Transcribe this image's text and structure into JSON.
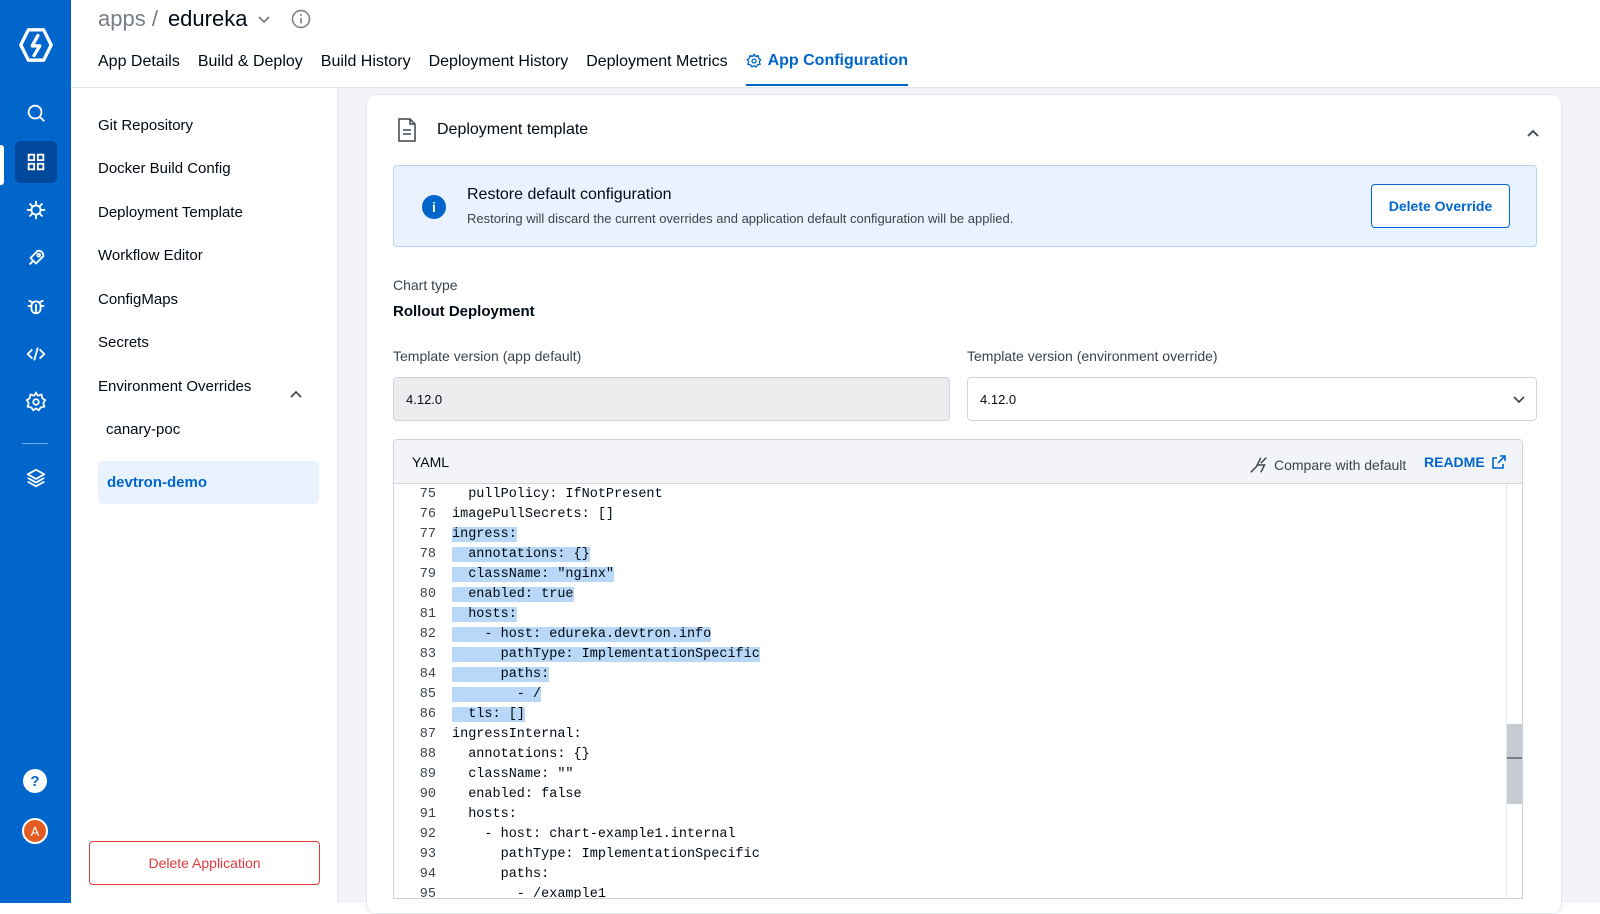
{
  "header": {
    "breadcrumb_parent": "apps /",
    "app_name": "edureka",
    "tabs": [
      "App Details",
      "Build & Deploy",
      "Build History",
      "Deployment History",
      "Deployment Metrics",
      "App Configuration"
    ]
  },
  "sidebar": {
    "items": [
      "Git Repository",
      "Docker Build Config",
      "Deployment Template",
      "Workflow Editor",
      "ConfigMaps",
      "Secrets",
      "Environment Overrides"
    ],
    "env_overrides": [
      "canary-poc",
      "devtron-demo"
    ],
    "delete_label": "Delete Application"
  },
  "rail": {
    "icons": [
      "devtron-logo-icon",
      "search-icon",
      "apps-grid-icon",
      "helm-wheel-icon",
      "rocket-icon",
      "bug-icon",
      "code-icon",
      "gear-icon",
      "stack-icon",
      "help-icon",
      "avatar"
    ],
    "avatar_initial": "A",
    "help_glyph": "?"
  },
  "main": {
    "card_title": "Deployment template",
    "restore": {
      "title": "Restore default configuration",
      "desc": "Restoring will discard the current overrides and application default configuration will be applied.",
      "button": "Delete Override",
      "info_glyph": "i"
    },
    "chart_type_label": "Chart type",
    "chart_type_value": "Rollout Deployment",
    "tv_default_label": "Template version (app default)",
    "tv_default_value": "4.12.0",
    "tv_override_label": "Template version (environment override)",
    "tv_override_value": "4.12.0",
    "yaml": {
      "title": "YAML",
      "compare": "Compare with default",
      "readme": "README",
      "lines": [
        {
          "n": "75",
          "t": "  pullPolicy: IfNotPresent",
          "hl": false
        },
        {
          "n": "76",
          "t": "imagePullSecrets: []",
          "hl": false
        },
        {
          "n": "77",
          "t": "ingress:",
          "hl": true
        },
        {
          "n": "78",
          "t": "  annotations: {}",
          "hl": true
        },
        {
          "n": "79",
          "t": "  className: \"nginx\"",
          "hl": true
        },
        {
          "n": "80",
          "t": "  enabled: true",
          "hl": true
        },
        {
          "n": "81",
          "t": "  hosts:",
          "hl": true
        },
        {
          "n": "82",
          "t": "    - host: edureka.devtron.info",
          "hl": true
        },
        {
          "n": "83",
          "t": "      pathType: ImplementationSpecific",
          "hl": true
        },
        {
          "n": "84",
          "t": "      paths:",
          "hl": true
        },
        {
          "n": "85",
          "t": "        - /",
          "hl": true
        },
        {
          "n": "86",
          "t": "  tls: []",
          "hl": true
        },
        {
          "n": "87",
          "t": "ingressInternal:",
          "hl": false
        },
        {
          "n": "88",
          "t": "  annotations: {}",
          "hl": false
        },
        {
          "n": "89",
          "t": "  className: \"\"",
          "hl": false
        },
        {
          "n": "90",
          "t": "  enabled: false",
          "hl": false
        },
        {
          "n": "91",
          "t": "  hosts:",
          "hl": false
        },
        {
          "n": "92",
          "t": "    - host: chart-example1.internal",
          "hl": false
        },
        {
          "n": "93",
          "t": "      pathType: ImplementationSpecific",
          "hl": false
        },
        {
          "n": "94",
          "t": "      paths:",
          "hl": false
        },
        {
          "n": "95",
          "t": "        - /example1",
          "hl": false
        }
      ]
    }
  },
  "colors": {
    "brand": "#0066cc",
    "danger": "#e23a3a",
    "selection": "#b9d7f7"
  }
}
